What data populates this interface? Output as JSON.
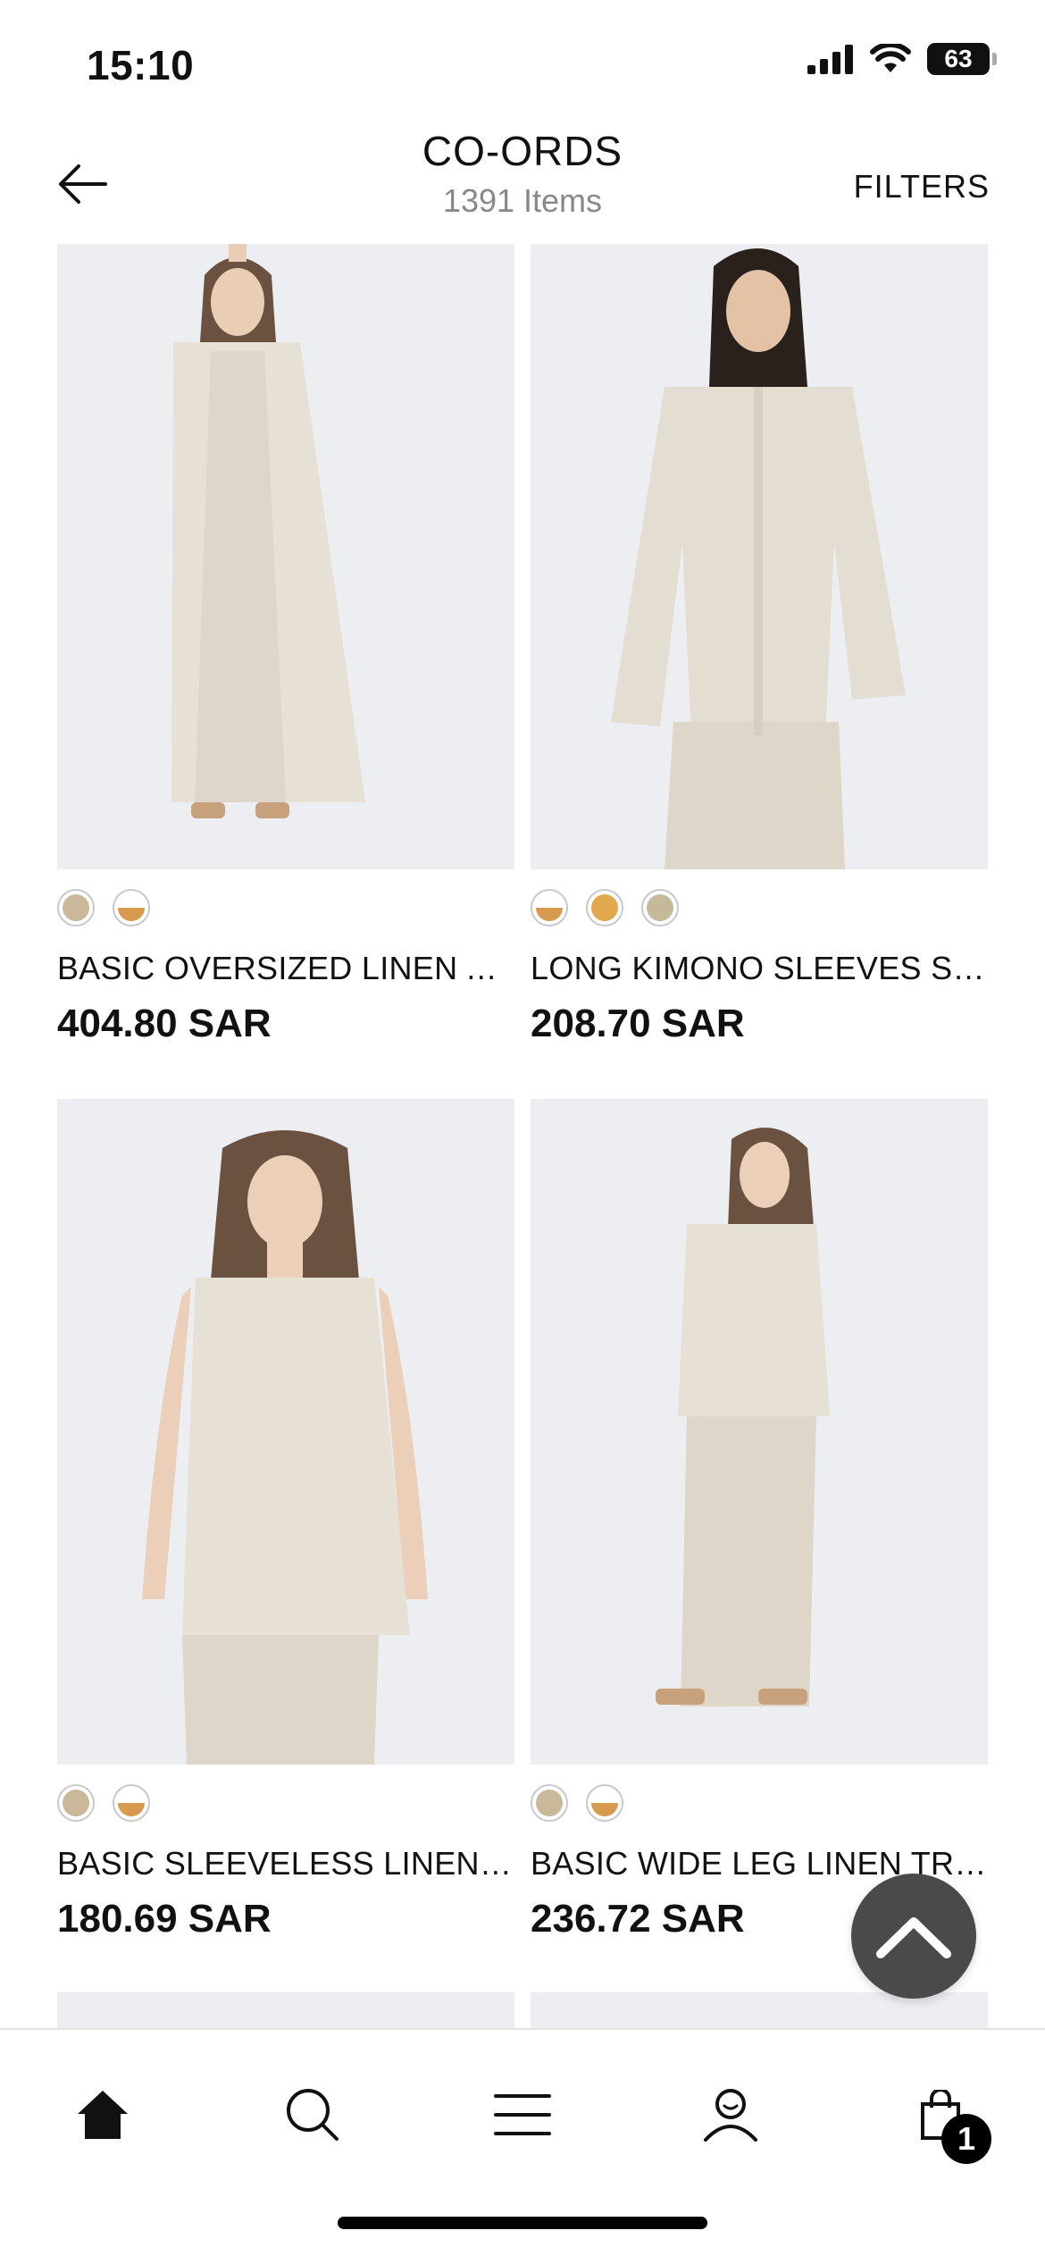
{
  "status_bar": {
    "time": "15:10",
    "battery": "63"
  },
  "header": {
    "title": "CO-ORDS",
    "item_count": "1391 Items",
    "filters_label": "FILTERS"
  },
  "products": [
    {
      "name": "BASIC OVERSIZED LINEN ABAYA",
      "price": "404.80 SAR",
      "swatches": [
        "#c9b99a",
        "half-orange"
      ]
    },
    {
      "name": "LONG KIMONO SLEEVES SHIRT",
      "price": "208.70 SAR",
      "swatches": [
        "half-orange",
        "#e2a94d",
        "#c6b89a"
      ]
    },
    {
      "name": "BASIC SLEEVELESS LINEN TOP",
      "price": "180.69 SAR",
      "swatches": [
        "#c9b99a",
        "half-orange"
      ]
    },
    {
      "name": "BASIC WIDE LEG LINEN TROUSERS",
      "price": "236.72 SAR",
      "swatches": [
        "#c9b99a",
        "half-orange"
      ]
    }
  ],
  "bottom_nav": {
    "items": [
      "home-icon",
      "search-icon",
      "menu-icon",
      "account-icon",
      "cart-icon"
    ],
    "cart_count": "1"
  },
  "colors": {
    "accent": "#111111",
    "fab": "#4a4a4a",
    "photo_bg": "#eceef2",
    "fabric": "#e3ddd2"
  }
}
